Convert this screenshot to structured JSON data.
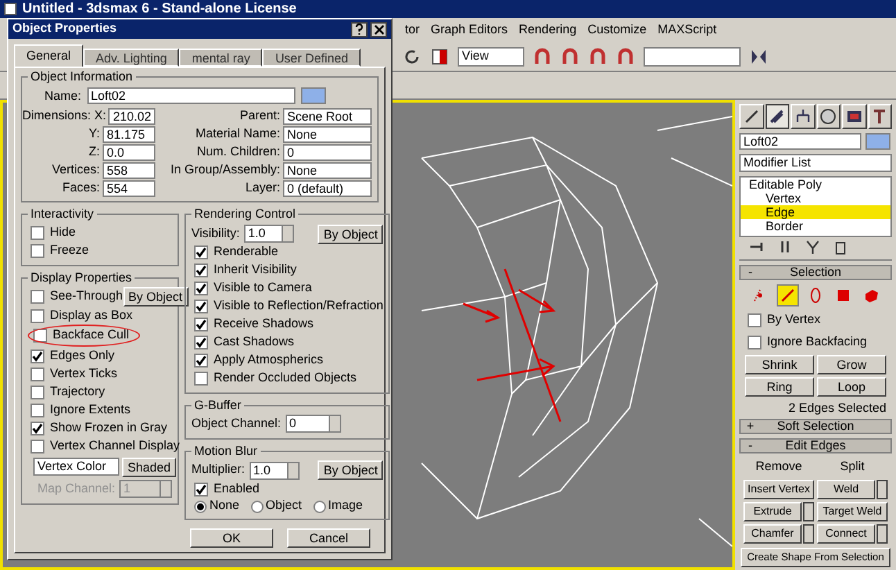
{
  "window": {
    "title": "Untitled - 3dsmax 6 - Stand-alone License"
  },
  "menu": [
    "tor",
    "Graph Editors",
    "Rendering",
    "Customize",
    "MAXScript"
  ],
  "toolbar": {
    "view_dropdown": "View"
  },
  "dialog": {
    "title": "Object Properties",
    "tabs": [
      {
        "label": "General",
        "selected": true
      },
      {
        "label": "Adv. Lighting",
        "selected": false
      },
      {
        "label": "mental ray",
        "selected": false
      },
      {
        "label": "User Defined",
        "selected": false
      }
    ],
    "object_information": {
      "title": "Object Information",
      "name_label": "Name:",
      "name": "Loft02",
      "left": [
        {
          "label": "Dimensions: X:",
          "value": "210.02"
        },
        {
          "label": "Y:",
          "value": "81.175"
        },
        {
          "label": "Z:",
          "value": "0.0"
        },
        {
          "label": "Vertices:",
          "value": "558"
        },
        {
          "label": "Faces:",
          "value": "554"
        }
      ],
      "right": [
        {
          "label": "Parent:",
          "value": "Scene Root"
        },
        {
          "label": "Material Name:",
          "value": "None"
        },
        {
          "label": "Num. Children:",
          "value": "0"
        },
        {
          "label": "In Group/Assembly:",
          "value": "None"
        },
        {
          "label": "Layer:",
          "value": "0 (default)"
        }
      ]
    },
    "interactivity": {
      "title": "Interactivity",
      "items": [
        {
          "label": "Hide",
          "checked": false
        },
        {
          "label": "Freeze",
          "checked": false
        }
      ]
    },
    "display_properties": {
      "title": "Display Properties",
      "by_object": "By Object",
      "items": [
        {
          "label": "See-Through",
          "checked": false,
          "circled": false
        },
        {
          "label": "Display as Box",
          "checked": false,
          "circled": false
        },
        {
          "label": "Backface Cull",
          "checked": false,
          "circled": true
        },
        {
          "label": "Edges Only",
          "checked": true,
          "circled": false
        },
        {
          "label": "Vertex Ticks",
          "checked": false,
          "circled": false
        },
        {
          "label": "Trajectory",
          "checked": false,
          "circled": false
        },
        {
          "label": "Ignore Extents",
          "checked": false,
          "circled": false
        },
        {
          "label": "Show Frozen in Gray",
          "checked": true,
          "circled": false
        },
        {
          "label": "Vertex Channel Display",
          "checked": false,
          "circled": false
        }
      ],
      "channel_dropdown": "Vertex Color",
      "shaded": "Shaded",
      "map_channel": {
        "label": "Map Channel:",
        "value": "1",
        "disabled": true
      }
    },
    "rendering_control": {
      "title": "Rendering Control",
      "visibility": {
        "label": "Visibility:",
        "value": "1.0"
      },
      "by_object": "By Object",
      "items": [
        {
          "label": "Renderable",
          "checked": true
        },
        {
          "label": "Inherit Visibility",
          "checked": true
        },
        {
          "label": "Visible to Camera",
          "checked": true
        },
        {
          "label": "Visible to Reflection/Refraction",
          "checked": true
        },
        {
          "label": "Receive Shadows",
          "checked": true
        },
        {
          "label": "Cast Shadows",
          "checked": true
        },
        {
          "label": "Apply Atmospherics",
          "checked": true
        },
        {
          "label": "Render Occluded Objects",
          "checked": false
        }
      ]
    },
    "g_buffer": {
      "title": "G-Buffer",
      "label": "Object Channel:",
      "value": "0"
    },
    "motion_blur": {
      "title": "Motion Blur",
      "label": "Multiplier:",
      "value": "1.0",
      "by_object": "By Object",
      "enabled": {
        "label": "Enabled",
        "checked": true
      },
      "options": [
        {
          "label": "None",
          "selected": true
        },
        {
          "label": "Object",
          "selected": false
        },
        {
          "label": "Image",
          "selected": false
        }
      ]
    },
    "buttons": [
      "OK",
      "Cancel"
    ]
  },
  "command_panel": {
    "tabs": [
      {
        "kind": "create",
        "selected": false
      },
      {
        "kind": "modify",
        "selected": true
      },
      {
        "kind": "hierarchy",
        "selected": false
      },
      {
        "kind": "motion",
        "selected": false
      },
      {
        "kind": "display",
        "selected": false
      },
      {
        "kind": "utilities",
        "selected": false
      }
    ],
    "object_name": "Loft02",
    "modifier_list": "Modifier List",
    "stack": [
      {
        "label": "Editable Poly",
        "selected": false,
        "children": [
          {
            "label": "Vertex",
            "selected": false
          },
          {
            "label": "Edge",
            "selected": true
          },
          {
            "label": "Border",
            "selected": false
          }
        ]
      }
    ],
    "selection": {
      "sign": "-",
      "title": "Selection",
      "subobjects": [
        {
          "kind": "vertex",
          "selected": false
        },
        {
          "kind": "edge",
          "selected": true
        },
        {
          "kind": "border",
          "selected": false
        },
        {
          "kind": "polygon",
          "selected": false
        },
        {
          "kind": "element",
          "selected": false
        }
      ],
      "options": [
        {
          "label": "By Vertex",
          "checked": false
        },
        {
          "label": "Ignore Backfacing",
          "checked": false
        }
      ],
      "buttons": [
        "Shrink",
        "Grow",
        "Ring",
        "Loop"
      ],
      "status": "2 Edges Selected"
    },
    "soft_selection": {
      "sign": "+",
      "title": "Soft Selection"
    },
    "edit_edges": {
      "sign": "-",
      "title": "Edit Edges",
      "buttons": [
        {
          "label": "Remove",
          "kind": "flat"
        },
        {
          "label": "Split",
          "kind": "flat"
        },
        {
          "label": "Insert Vertex",
          "kind": "plain"
        },
        {
          "label": "Weld",
          "kind": "settings"
        },
        {
          "label": "Extrude",
          "kind": "settings"
        },
        {
          "label": "Target Weld",
          "kind": "plain"
        },
        {
          "label": "Chamfer",
          "kind": "settings"
        },
        {
          "label": "Connect",
          "kind": "settings"
        }
      ],
      "wide_button": "Create Shape From Selection"
    }
  }
}
